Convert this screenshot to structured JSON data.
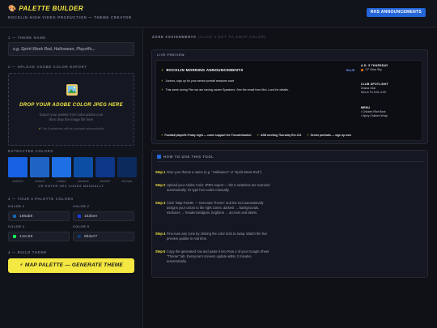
{
  "header": {
    "title": "PALETTE BUILDER",
    "subtitle": "ROCKLIN HIGH VIDEO PRODUCTION — THEME CREATOR",
    "tag": "RHS ANNOUNCEMENTS"
  },
  "left": {
    "s1_label": "1 — THEME NAME",
    "theme_placeholder": "e.g. Spirit Week Red, Halloween, Playoffs...",
    "s2_label": "2 — UPLOAD ADOBE COLOR EXPORT",
    "upload_title": "DROP YOUR ADOBE COLOR JPEG HERE",
    "upload_line1": "Export your palette from color.adobe.com",
    "upload_line2": "then drop the image file here",
    "upload_note": "The 5 swatches will be scanned automatically",
    "extracted_label": "EXTRACTED COLORS",
    "swatches": [
      {
        "hex": "#1662e2",
        "color": "#1662e2"
      },
      {
        "hex": "#1f64c5",
        "color": "#1f64c5"
      },
      {
        "hex": "#1f6fe4",
        "color": "#1f6fe4"
      },
      {
        "hex": "#0d4ea5",
        "color": "#0d4ea5"
      },
      {
        "hex": "#0d3687",
        "color": "#0d3687"
      },
      {
        "hex": "#0c2a5c",
        "color": "#0c2a5c"
      }
    ],
    "hex_note": "OR ENTER HEX CODES MANUALLY",
    "s3_label": "3 — YOUR 5 PALETTE COLORS",
    "colors": [
      {
        "label": "COLOR 1",
        "value": "166ab0",
        "swatch": "#166ab0"
      },
      {
        "label": "COLOR 2",
        "value": "153bee",
        "swatch": "#153bee"
      },
      {
        "label": "COLOR 4",
        "value": "11ec59",
        "swatch": "#11ec59"
      },
      {
        "label": "COLOR 5",
        "value": "0b3a77",
        "swatch": "#0b3a77"
      }
    ],
    "s4_label": "4 — BUILD THEME",
    "map_button": "MAP PALETTE — GENERATE THEME"
  },
  "right": {
    "zone_title": "ZONE ASSIGNMENTS",
    "zone_hint": "(CLICK A DOT TO SWAP COLOR)",
    "preview_label": "LIVE PREVIEW",
    "pv_heading": "ROCKLIN MORNING ANNOUNCEMENTS",
    "pv_blue": "BLUE",
    "pv_ann1": "Juniors, sign up for your senior portrait sessions now!",
    "pv_ann2": "This week during Flex we are having career Speakers. See the email from Mrs. Lund for details.",
    "pv_date_k": "A.D. 5 THURSDAY",
    "pv_date_v": "74° Clear Sky",
    "pv_spot_k": "CLUB SPOTLIGHT",
    "pv_spot_v1": "Drama Club",
    "pv_spot_v2": "Mon & Fri 3:00–4:00",
    "pv_menu_k": "MENU",
    "pv_menu_v1": "• Chicken Rice Bowl",
    "pv_menu_v2": "• Spicy Chicken Wrap",
    "ticker": [
      "Football playoffs Friday night — come support the Thunderhawks!",
      "ASB meeting Thursday Rm 214",
      "Senior portraits — sign up now"
    ],
    "howto_title": "HOW TO USE THIS TOOL",
    "steps": [
      {
        "n": "Step 1",
        "t": "Give your theme a name (e.g. \"Halloween\" or \"Spirit Week Red\")"
      },
      {
        "n": "Step 2",
        "t": "Upload your Adobe Color JPEG export — the 5 swatches are scanned automatically. Or type hex codes manually."
      },
      {
        "n": "Step 3",
        "t": "Click \"Map Palette — Generate Theme\" and the tool automatically assigns your colors to the right zones: darkest → backgrounds, midtones → headers/widgets, brightest → accents and labels."
      },
      {
        "n": "Step 4",
        "t": "Fine-tune any zone by clicking the color dots to swap. Watch the live preview update in real time."
      },
      {
        "n": "Step 5",
        "t": "Copy the generated row and paste it into Row 2 of your Google Sheet \"Theme\" tab. Everyone's screens update within 2 minutes automatically."
      }
    ]
  }
}
